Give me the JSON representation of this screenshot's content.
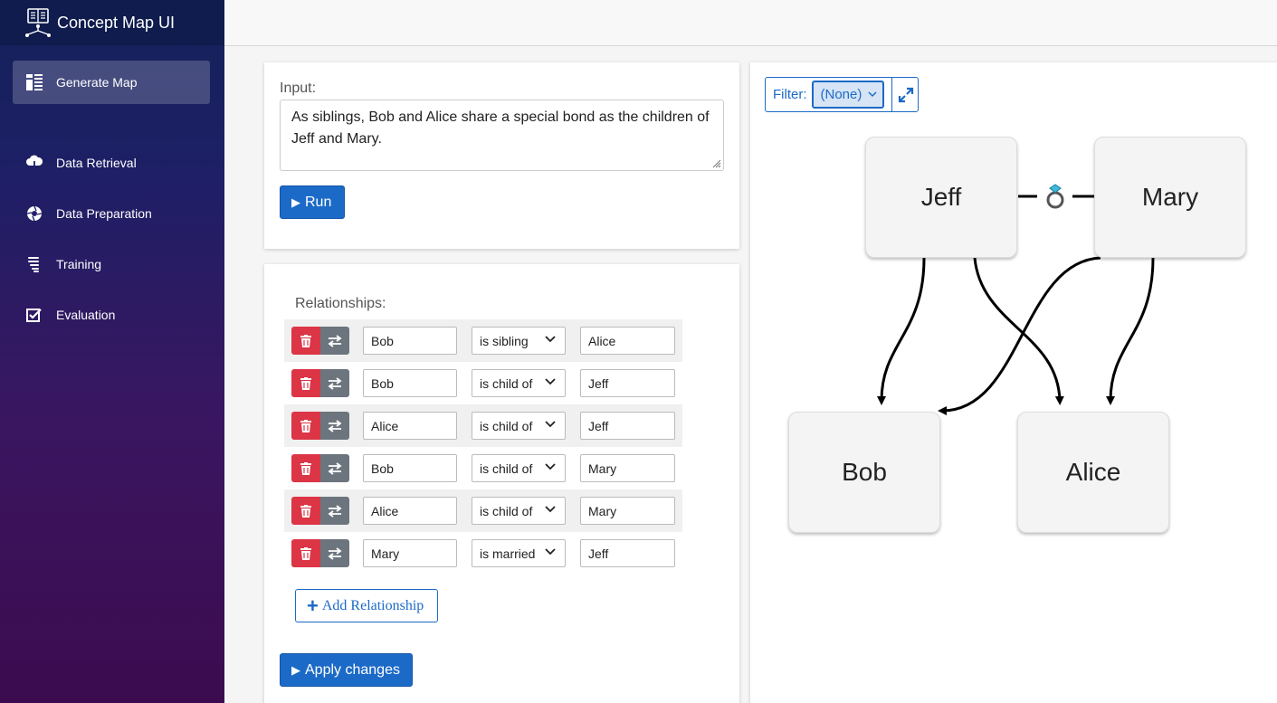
{
  "app": {
    "title": "Concept Map UI"
  },
  "sidebar": {
    "items": [
      {
        "label": "Generate Map",
        "icon": "dashboard-icon",
        "active": true
      },
      {
        "label": "Data Retrieval",
        "icon": "cloud-download-icon",
        "active": false
      },
      {
        "label": "Data Preparation",
        "icon": "aperture-icon",
        "active": false
      },
      {
        "label": "Training",
        "icon": "training-icon",
        "active": false
      },
      {
        "label": "Evaluation",
        "icon": "checkbox-icon",
        "active": false
      }
    ]
  },
  "input_panel": {
    "label": "Input:",
    "text": "As siblings, Bob and Alice share a special bond as the children of Jeff and Mary.",
    "run_label": "Run"
  },
  "relationships_panel": {
    "title": "Relationships:",
    "rows": [
      {
        "subject": "Bob",
        "relation": "is sibling",
        "object": "Alice"
      },
      {
        "subject": "Bob",
        "relation": "is child of",
        "object": "Jeff"
      },
      {
        "subject": "Alice",
        "relation": "is child of",
        "object": "Jeff"
      },
      {
        "subject": "Bob",
        "relation": "is child of",
        "object": "Mary"
      },
      {
        "subject": "Alice",
        "relation": "is child of",
        "object": "Mary"
      },
      {
        "subject": "Mary",
        "relation": "is married",
        "object": "Jeff"
      }
    ],
    "add_label": "Add Relationship",
    "apply_label": "Apply changes"
  },
  "map_panel": {
    "filter_label": "Filter:",
    "filter_value": "(None)",
    "nodes": {
      "jeff": "Jeff",
      "mary": "Mary",
      "bob": "Bob",
      "alice": "Alice"
    }
  },
  "colors": {
    "primary": "#1c6ac7",
    "danger": "#dc3545",
    "secondary": "#6c757d",
    "ring": "#3fb8d8"
  }
}
